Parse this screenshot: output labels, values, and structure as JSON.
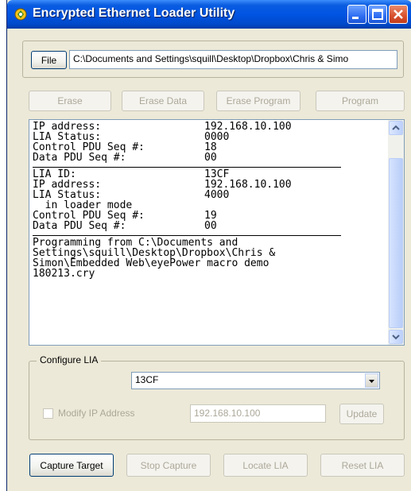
{
  "window": {
    "title": "Encrypted Ethernet Loader Utility"
  },
  "file": {
    "button_label": "File",
    "path": "C:\\Documents and Settings\\squill\\Desktop\\Dropbox\\Chris & Simo"
  },
  "program_buttons": {
    "erase": "Erase",
    "erase_data": "Erase Data",
    "erase_program": "Erase Program",
    "program": "Program"
  },
  "log": {
    "block1": [
      {
        "key": "IP address:",
        "value": "192.168.10.100"
      },
      {
        "key": "LIA Status:",
        "value": "0000"
      },
      {
        "key": "Control PDU Seq #:",
        "value": "18"
      },
      {
        "key": "Data PDU Seq #:",
        "value": "00"
      }
    ],
    "block2": [
      {
        "key": "LIA ID:",
        "value": "13CF"
      },
      {
        "key": "IP address:",
        "value": "192.168.10.100"
      },
      {
        "key": "LIA Status:",
        "value": "4000"
      },
      {
        "key": "  in loader mode",
        "value": ""
      },
      {
        "key": "Control PDU Seq #:",
        "value": "19"
      },
      {
        "key": "Data PDU Seq #:",
        "value": "00"
      }
    ],
    "message_lines": [
      "Programming from C:\\Documents and",
      "Settings\\squill\\Desktop\\Dropbox\\Chris &",
      "Simon\\Embedded Web\\eyePower macro demo",
      "180213.cry"
    ]
  },
  "configure": {
    "legend": "Configure LIA",
    "selected_lia": "13CF",
    "modify_ip_label": "Modify IP Address",
    "modify_ip_checked": false,
    "ip_value": "192.168.10.100",
    "update_label": "Update"
  },
  "bottom_buttons": {
    "capture_target": "Capture Target",
    "stop_capture": "Stop Capture",
    "locate_lia": "Locate LIA",
    "reset_lia": "Reset LIA"
  },
  "icons": {
    "app": "app-icon",
    "minimize": "minimize-icon",
    "maximize": "maximize-icon",
    "close": "close-icon",
    "scroll_up": "chevron-up-icon",
    "scroll_down": "chevron-down-icon",
    "dropdown": "chevron-down-icon"
  },
  "colors": {
    "titlebar": "#0054e3",
    "dialog_bg": "#ece9d8",
    "disabled_text": "#aca899",
    "close_button": "#d8502e"
  }
}
